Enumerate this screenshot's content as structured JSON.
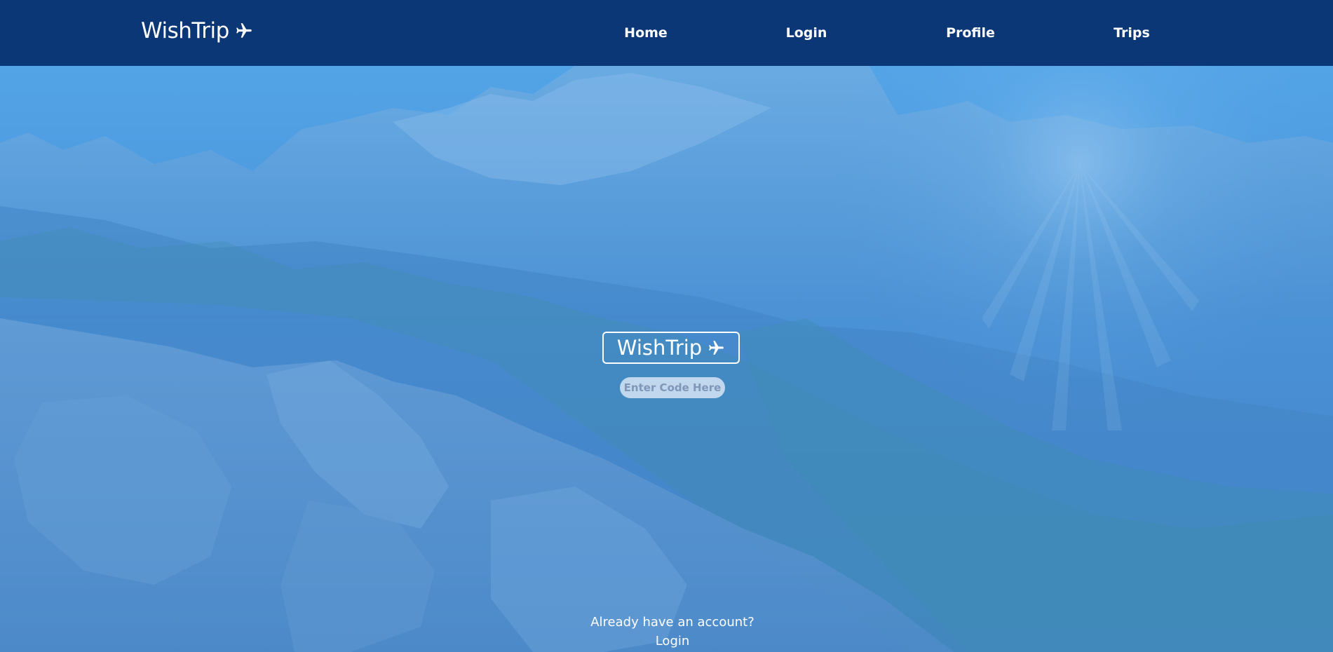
{
  "navbar": {
    "brand": "WishTrip",
    "brand_icon": "airplane-icon",
    "links": [
      {
        "label": "Home"
      },
      {
        "label": "Login"
      },
      {
        "label": "Profile"
      },
      {
        "label": "Trips"
      }
    ]
  },
  "hero": {
    "logo_text": "WishTrip",
    "logo_icon": "airplane-icon",
    "code_input": {
      "placeholder": "Enter Code Here",
      "value": ""
    },
    "account_prompt": "Already have an account?",
    "login_link": "Login"
  },
  "colors": {
    "navbar_bg": "#0b3776",
    "hero_tint": "#4a96de",
    "text": "#ffffff"
  }
}
